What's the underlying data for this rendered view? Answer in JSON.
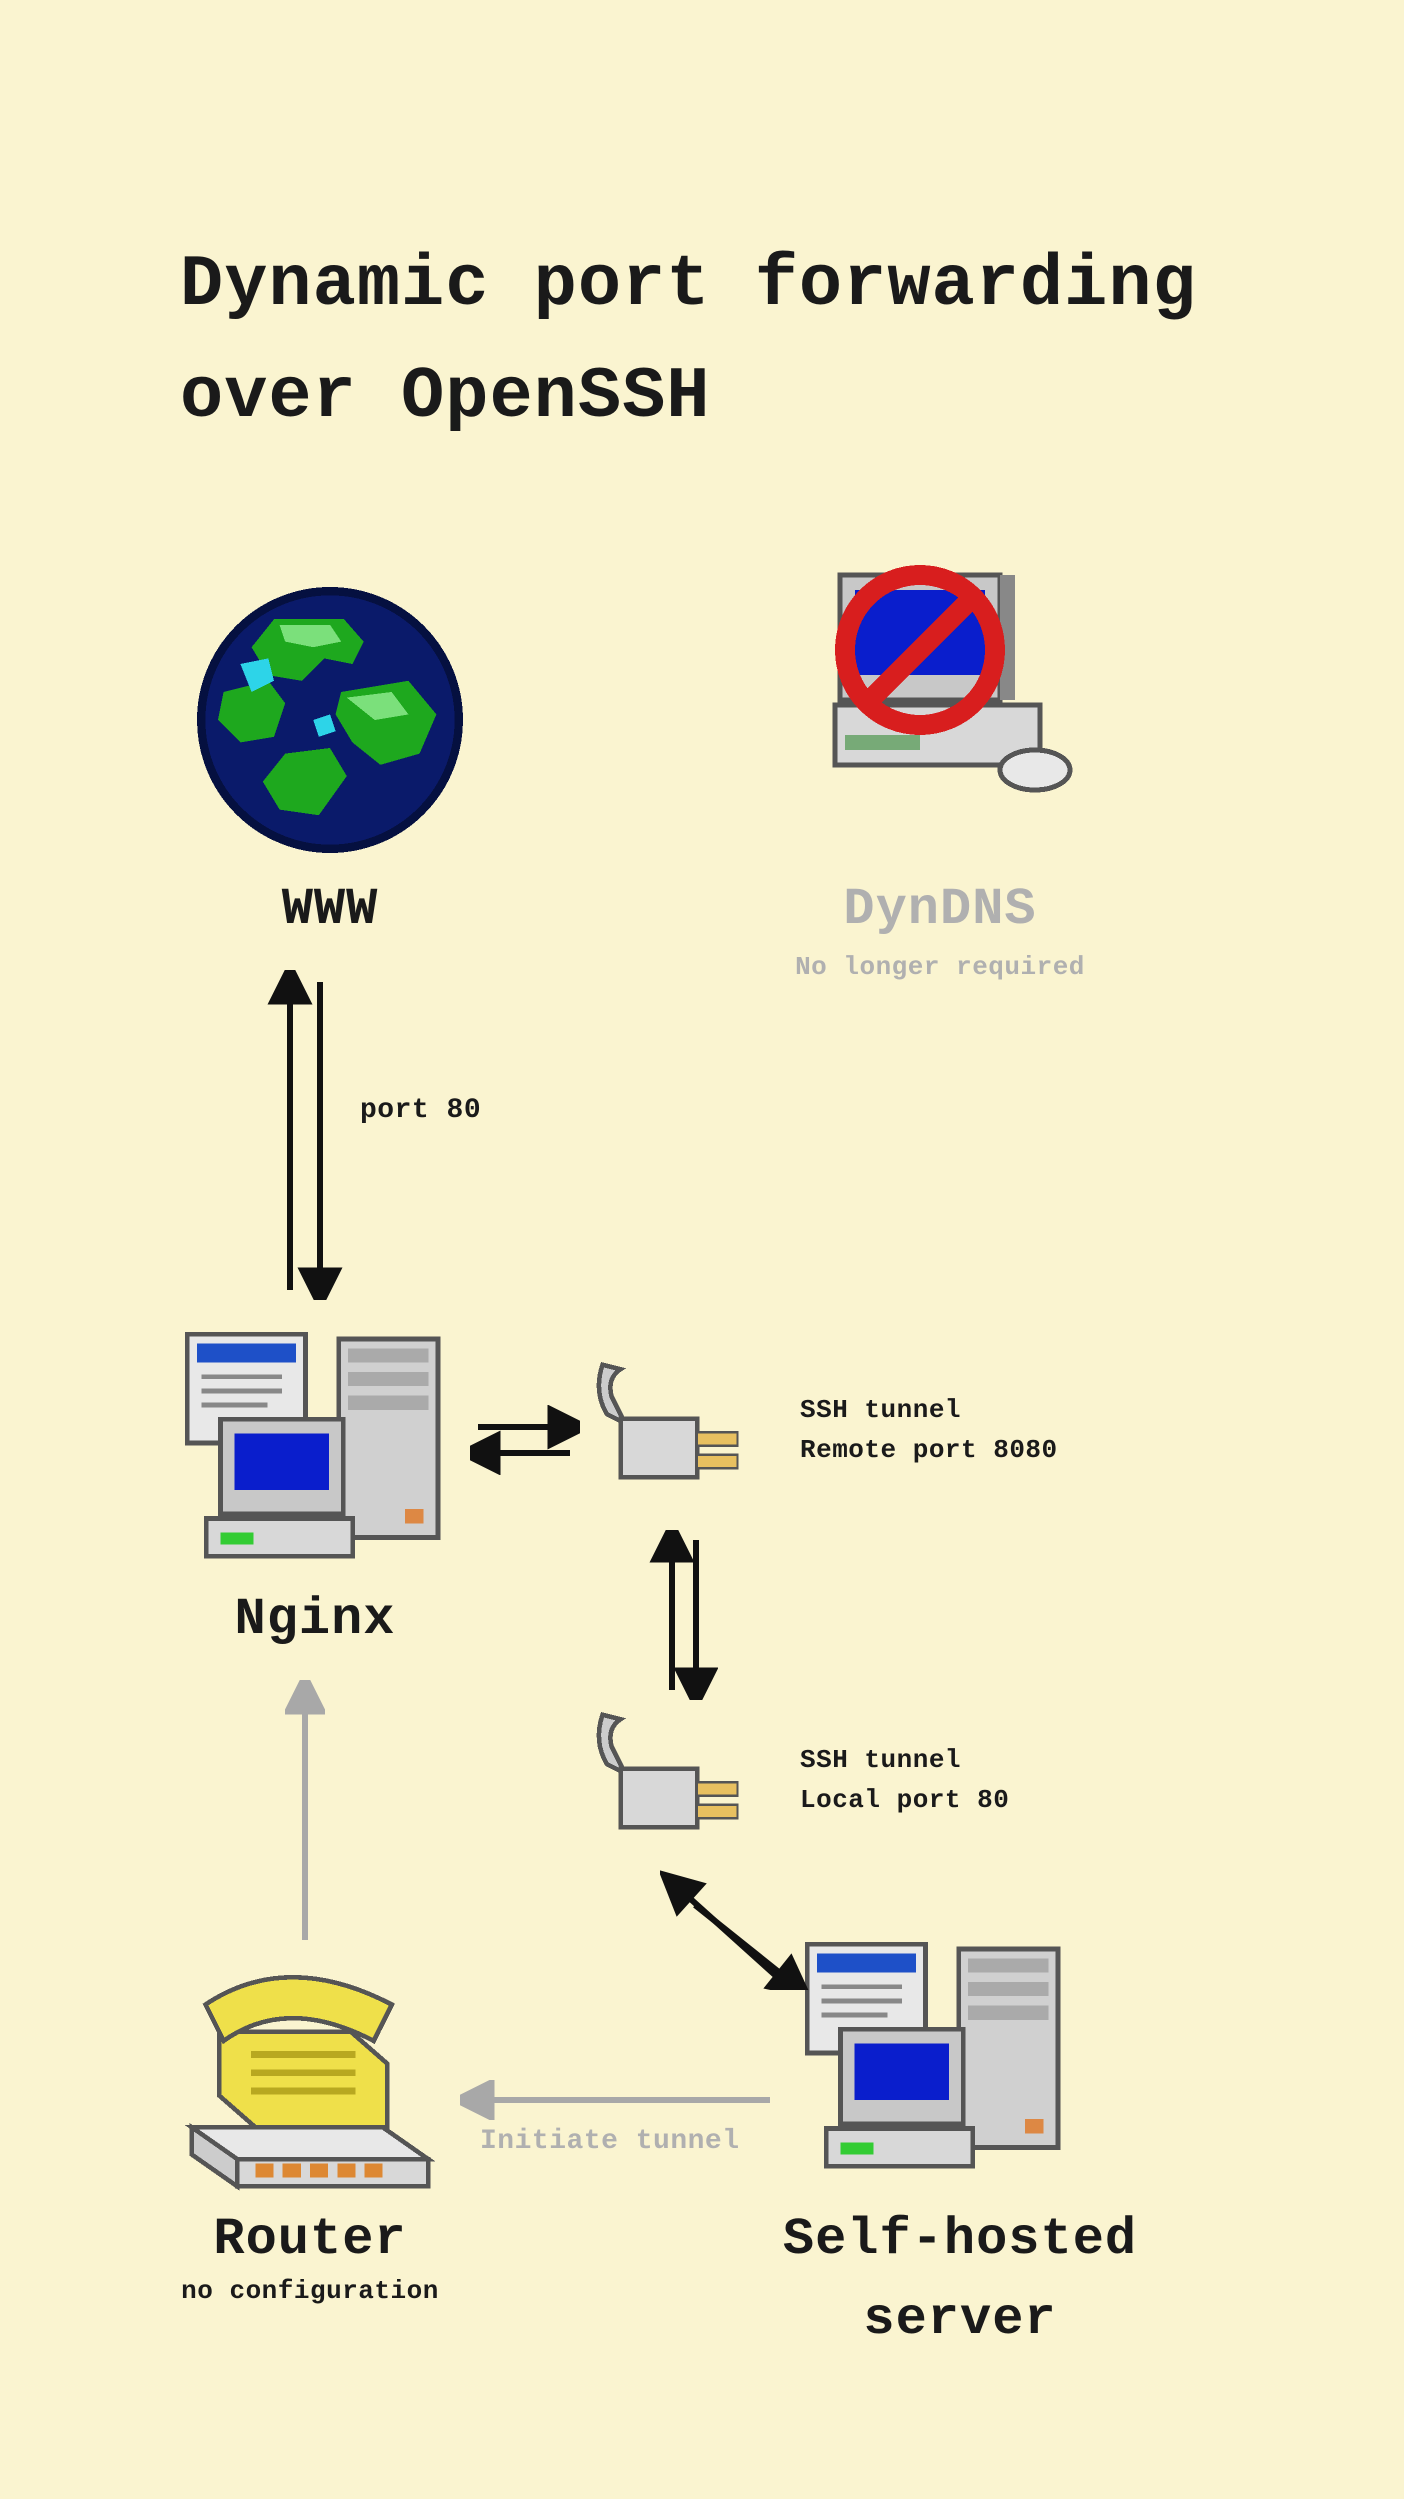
{
  "title": "Dynamic port forwarding over OpenSSH",
  "nodes": {
    "www": {
      "label": "WWW"
    },
    "dyndns": {
      "label": "DynDNS",
      "sub": "No longer required"
    },
    "nginx": {
      "label": "Nginx"
    },
    "sshRemote": {
      "line1": "SSH tunnel",
      "line2": "Remote port 8080"
    },
    "sshLocal": {
      "line1": "SSH tunnel",
      "line2": "Local port 80"
    },
    "router": {
      "label": "Router",
      "sub": "no configuration"
    },
    "selfhost": {
      "label1": "Self-hosted",
      "label2": "server"
    }
  },
  "edges": {
    "wwwNginx": {
      "label": "port 80"
    },
    "initiate": {
      "label": "Initiate tunnel"
    }
  }
}
